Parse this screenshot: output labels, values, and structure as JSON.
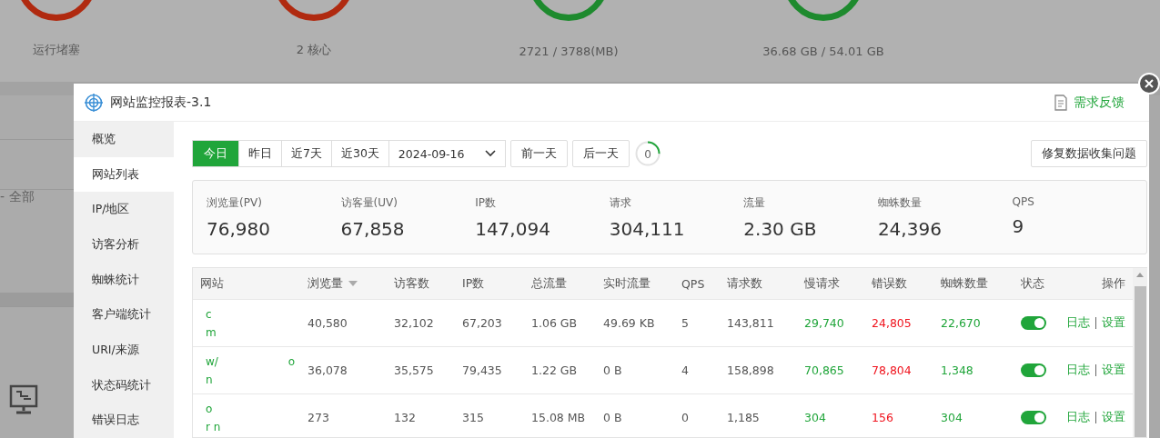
{
  "backdrop": {
    "gauges": [
      {
        "label": "运行堵塞",
        "color": "#b02a10"
      },
      {
        "label": "2 核心",
        "color": "#b02a10"
      },
      {
        "label": "2721 / 3788(MB)",
        "color": "#1e8a2e"
      },
      {
        "label": "36.68 GB / 54.01 GB",
        "color": "#1e8a2e"
      }
    ],
    "filter_label": "- 全部"
  },
  "dialog": {
    "title": "网站监控报表-3.1",
    "feedback": "需求反馈",
    "sidebar": {
      "items": [
        {
          "label": "概览",
          "selected": false
        },
        {
          "label": "网站列表",
          "selected": true
        },
        {
          "label": "IP/地区",
          "selected": false
        },
        {
          "label": "访客分析",
          "selected": false
        },
        {
          "label": "蜘蛛统计",
          "selected": false
        },
        {
          "label": "客户端统计",
          "selected": false
        },
        {
          "label": "URI/来源",
          "selected": false
        },
        {
          "label": "状态码统计",
          "selected": false
        },
        {
          "label": "错误日志",
          "selected": false
        }
      ]
    },
    "range_tabs": [
      {
        "label": "今日",
        "selected": true
      },
      {
        "label": "昨日",
        "selected": false
      },
      {
        "label": "近7天",
        "selected": false
      },
      {
        "label": "近30天",
        "selected": false
      }
    ],
    "date": "2024-09-16",
    "prev_day": "前一天",
    "next_day": "后一天",
    "refresh_count": "0",
    "fix_button": "修复数据收集问题",
    "stats": [
      {
        "label": "浏览量(PV)",
        "value": "76,980"
      },
      {
        "label": "访客量(UV)",
        "value": "67,858"
      },
      {
        "label": "IP数",
        "value": "147,094"
      },
      {
        "label": "请求",
        "value": "304,111"
      },
      {
        "label": "流量",
        "value": "2.30 GB"
      },
      {
        "label": "蜘蛛数量",
        "value": "24,396"
      },
      {
        "label": "QPS",
        "value": "9"
      }
    ],
    "table": {
      "columns": [
        {
          "label": "网站",
          "kind": "link"
        },
        {
          "label": "浏览量",
          "kind": "plain",
          "sorted": true
        },
        {
          "label": "访客数",
          "kind": "plain"
        },
        {
          "label": "IP数",
          "kind": "plain"
        },
        {
          "label": "总流量",
          "kind": "plain"
        },
        {
          "label": "实时流量",
          "kind": "plain"
        },
        {
          "label": "QPS",
          "kind": "plain"
        },
        {
          "label": "请求数",
          "kind": "plain"
        },
        {
          "label": "慢请求",
          "kind": "good"
        },
        {
          "label": "错误数",
          "kind": "bad"
        },
        {
          "label": "蜘蛛数量",
          "kind": "good"
        },
        {
          "label": "状态"
        },
        {
          "label": "操作"
        }
      ],
      "rows": [
        {
          "cells": [
            [
              [
                "c"
              ],
              [
                "m"
              ]
            ],
            "40,580",
            "32,102",
            "67,203",
            "1.06 GB",
            "49.69 KB",
            "5",
            "143,811",
            "29,740",
            "24,805",
            "22,670"
          ],
          "on": true,
          "actions": [
            "日志",
            "设置"
          ]
        },
        {
          "cells": [
            [
              [
                "w/",
                "o"
              ],
              [
                "n"
              ]
            ],
            "36,078",
            "35,575",
            "79,435",
            "1.22 GB",
            "0 B",
            "4",
            "158,898",
            "70,865",
            "78,804",
            "1,348"
          ],
          "on": true,
          "actions": [
            "日志",
            "设置"
          ]
        },
        {
          "cells": [
            [
              [
                "o"
              ],
              [
                "r n"
              ]
            ],
            "273",
            "132",
            "315",
            "15.08 MB",
            "0 B",
            "0",
            "1,185",
            "304",
            "156",
            "304"
          ],
          "on": true,
          "actions": [
            "日志",
            "设置"
          ]
        }
      ]
    }
  }
}
